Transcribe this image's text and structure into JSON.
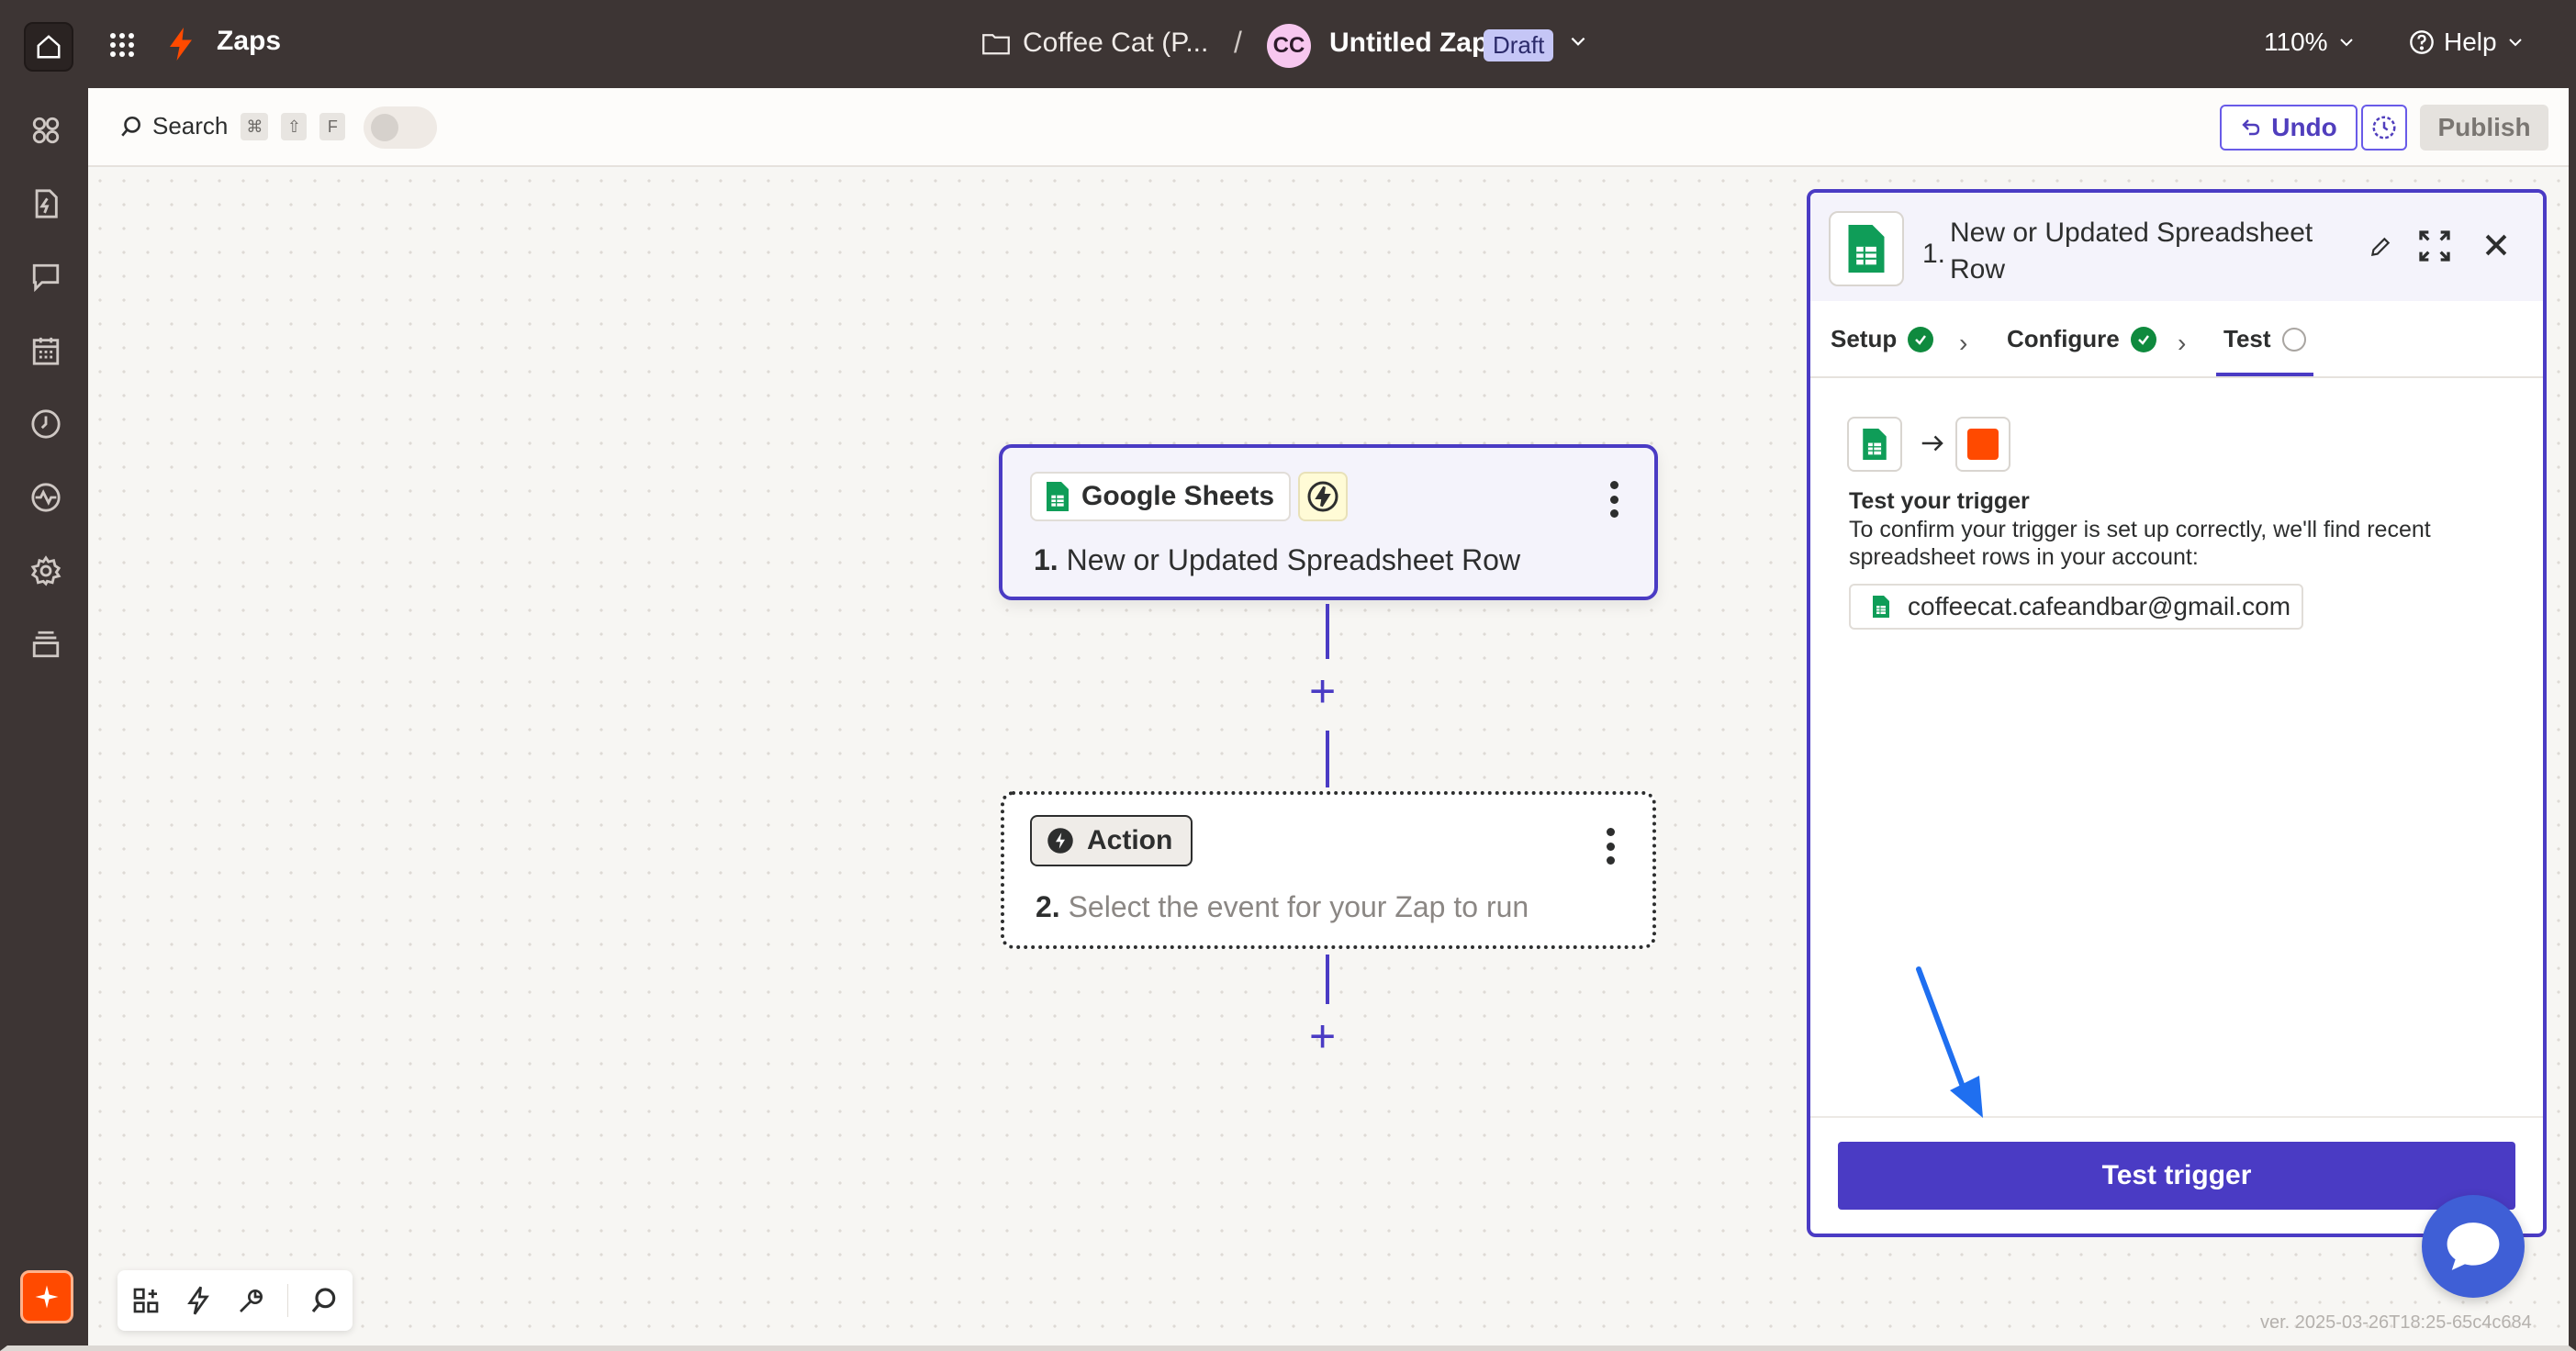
{
  "topbar": {
    "app_name": "Zaps",
    "folder": "Coffee Cat (P...",
    "separator": "/",
    "avatar_initials": "CC",
    "zap_title": "Untitled Zap",
    "status_badge": "Draft",
    "zoom": "110%",
    "help": "Help"
  },
  "toolbar": {
    "search_label": "Search",
    "shortcut_keys": [
      "⌘",
      "⇧",
      "F"
    ],
    "undo_label": "Undo",
    "publish_label": "Publish"
  },
  "canvas": {
    "step1": {
      "app_name": "Google Sheets",
      "number": "1.",
      "title": "New or Updated Spreadsheet Row"
    },
    "step2": {
      "chip_label": "Action",
      "number": "2.",
      "title": "Select the event for your Zap to run"
    }
  },
  "panel": {
    "number": "1.",
    "title": "New or Updated Spreadsheet Row",
    "tabs": [
      {
        "label": "Setup",
        "status": "complete"
      },
      {
        "label": "Configure",
        "status": "complete"
      },
      {
        "label": "Test",
        "status": "active"
      }
    ],
    "test_heading": "Test your trigger",
    "test_description": "To confirm your trigger is set up correctly, we'll find recent spreadsheet rows in your account:",
    "account": "coffeecat.cafeandbar@gmail.com",
    "test_button": "Test trigger"
  },
  "footer": {
    "version": "ver. 2025-03-26T18:25-65c4c684"
  },
  "colors": {
    "brand_orange": "#ff4a00",
    "primary_purple": "#4a3bc4",
    "sheets_green": "#0f9d58",
    "topbar_bg": "#3d3534"
  }
}
